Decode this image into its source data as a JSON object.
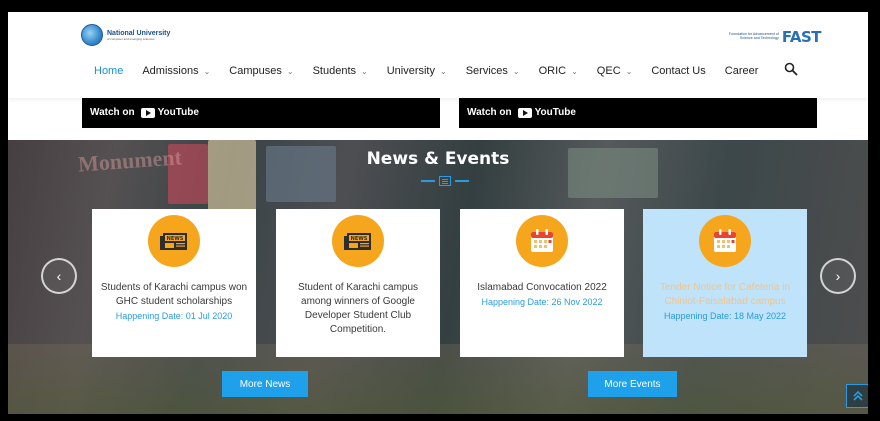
{
  "header": {
    "logo_title": "National University",
    "logo_subtitle": "of computer and emerging sciences",
    "fast_tagline": "Foundation for Advancement of Science and Technology",
    "fast_logo": "FAST"
  },
  "nav": {
    "items": [
      {
        "label": "Home",
        "active": true,
        "dropdown": false
      },
      {
        "label": "Admissions",
        "dropdown": true
      },
      {
        "label": "Campuses",
        "dropdown": true
      },
      {
        "label": "Students",
        "dropdown": true
      },
      {
        "label": "University",
        "dropdown": true
      },
      {
        "label": "Services",
        "dropdown": true
      },
      {
        "label": "ORIC",
        "dropdown": true
      },
      {
        "label": "QEC",
        "dropdown": true
      },
      {
        "label": "Contact Us",
        "dropdown": false
      },
      {
        "label": "Career",
        "dropdown": false
      }
    ]
  },
  "videos": {
    "watch_label": "Watch on",
    "youtube_label": "YouTube"
  },
  "news": {
    "background_text": "Monument",
    "title": "News & Events",
    "cards": [
      {
        "icon": "newspaper-icon",
        "text": "Students of Karachi campus won GHC student scholarships",
        "date": "Happening Date: 01 Jul 2020"
      },
      {
        "icon": "newspaper-icon",
        "text": "Student of Karachi campus among winners of Google Developer Student Club Competition.",
        "date": ""
      },
      {
        "icon": "calendar-icon",
        "text": "Islamabad Convocation 2022",
        "date": "Happening Date: 26 Nov 2022"
      },
      {
        "icon": "calendar-icon",
        "text": "Tender Notice for Cafeteria in Chiniot-Faisalabad campus",
        "date": "Happening Date: 18 May 2022"
      }
    ],
    "more_news": "More News",
    "more_events": "More Events"
  },
  "colors": {
    "accent": "#1ea0ea",
    "icon_orange": "#f5a61c",
    "highlight_card": "#bfe3fb"
  }
}
